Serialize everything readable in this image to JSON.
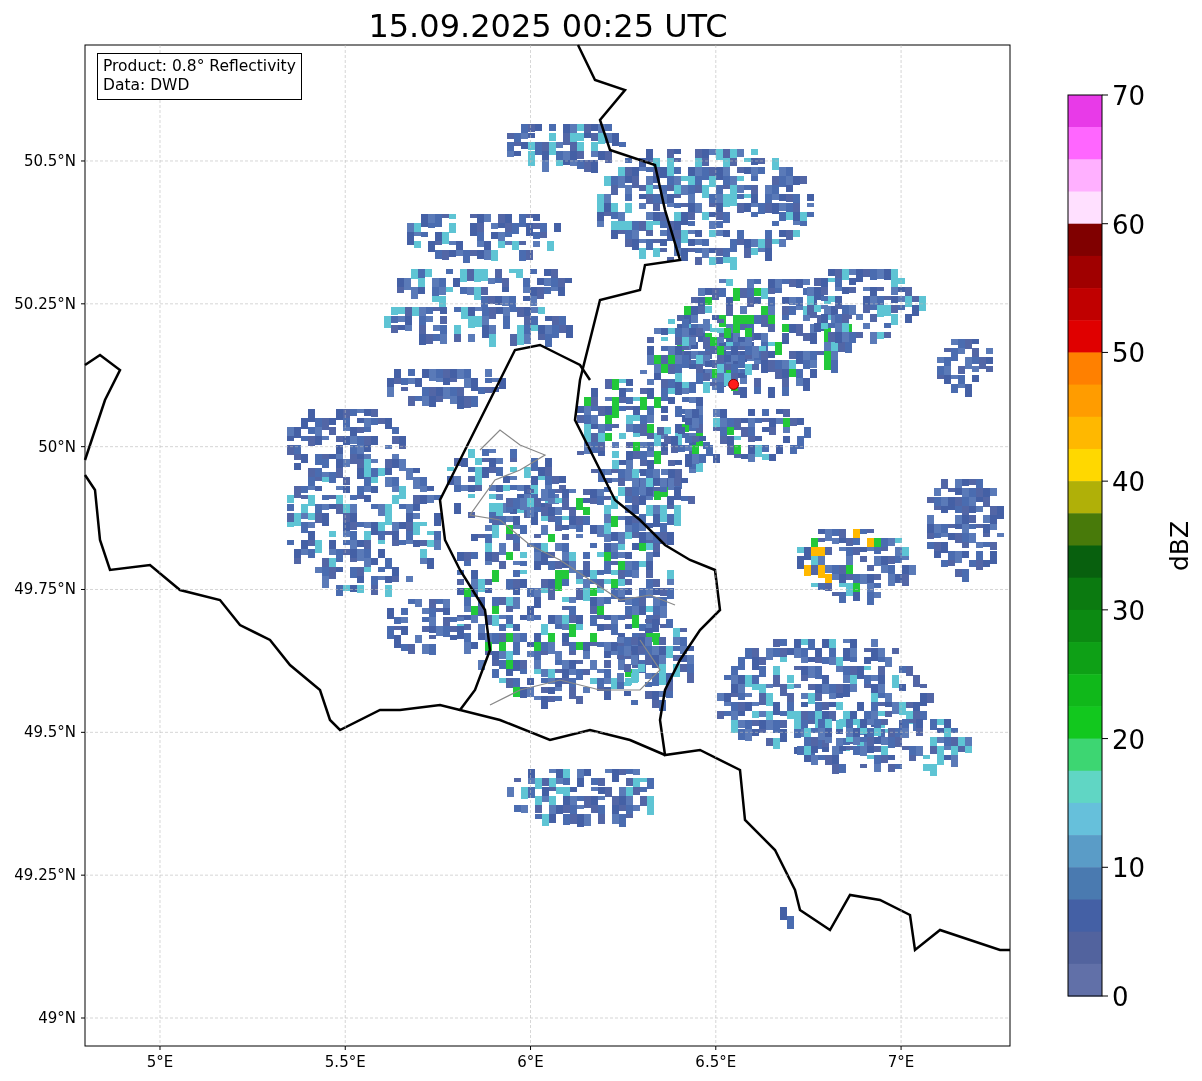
{
  "chart_data": {
    "type": "scatter",
    "title": "15.09.2025 00:25 UTC",
    "grid": true,
    "xlim": [
      4.7976,
      7.294
    ],
    "ylim": [
      48.951,
      50.703
    ],
    "xticks": [
      {
        "value": 5,
        "label": "5°E"
      },
      {
        "value": 5.5,
        "label": "5.5°E"
      },
      {
        "value": 6,
        "label": "6°E"
      },
      {
        "value": 6.5,
        "label": "6.5°E"
      },
      {
        "value": 7,
        "label": "7°E"
      }
    ],
    "yticks": [
      {
        "value": 50.5,
        "label": "50.5°N"
      },
      {
        "value": 50.25,
        "label": "50.25°N"
      },
      {
        "value": 50,
        "label": "50°N"
      },
      {
        "value": 49.75,
        "label": "49.75°N"
      },
      {
        "value": 49.5,
        "label": "49.5°N"
      },
      {
        "value": 49.25,
        "label": "49.25°N"
      },
      {
        "value": 49,
        "label": "49°N"
      }
    ],
    "x": [
      6.548
    ],
    "series": [
      {
        "color": "#ff1a1a",
        "values": [
          50.109
        ]
      }
    ]
  },
  "legend": {
    "lines": [
      "Product: 0.8° Reflectivity",
      "Data: DWD"
    ]
  },
  "colorbar": {
    "label": "dBZ",
    "ticks": [
      "70",
      "60",
      "50",
      "40",
      "30",
      "20",
      "10",
      "0"
    ],
    "bins": [
      {
        "color": "#e83ae8"
      },
      {
        "color": "#ff66ff"
      },
      {
        "color": "#ffb0ff"
      },
      {
        "color": "#ffe0ff"
      },
      {
        "color": "#800000"
      },
      {
        "color": "#a00000"
      },
      {
        "color": "#c00000"
      },
      {
        "color": "#e00000"
      },
      {
        "color": "#ff8000"
      },
      {
        "color": "#ff9c00"
      },
      {
        "color": "#ffb800"
      },
      {
        "color": "#ffd800"
      },
      {
        "color": "#b0b008"
      },
      {
        "color": "#487a0a"
      },
      {
        "color": "#08600e"
      },
      {
        "color": "#0b7a10"
      },
      {
        "color": "#0c8a12"
      },
      {
        "color": "#0ea016"
      },
      {
        "color": "#10b81a"
      },
      {
        "color": "#12c81e"
      },
      {
        "color": "#3dd672"
      },
      {
        "color": "#60d6c4"
      },
      {
        "color": "#66c0db"
      },
      {
        "color": "#5a9cc7"
      },
      {
        "color": "#4a7ab0"
      },
      {
        "color": "#4460a5"
      },
      {
        "color": "#52639e"
      },
      {
        "color": "#6170a8"
      }
    ]
  }
}
